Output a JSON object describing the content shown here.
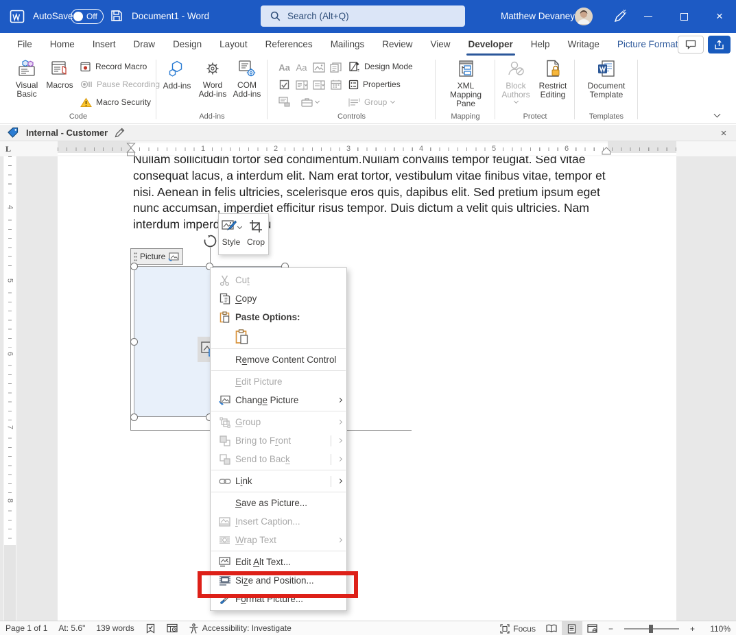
{
  "window": {
    "autosave_label": "AutoSave",
    "autosave_state": "Off",
    "title": "Document1 - Word",
    "search_placeholder": "Search (Alt+Q)",
    "user_name": "Matthew Devaney"
  },
  "ribbon": {
    "tabs": [
      "File",
      "Home",
      "Insert",
      "Draw",
      "Design",
      "Layout",
      "References",
      "Mailings",
      "Review",
      "View",
      "Developer",
      "Help",
      "Writage",
      "Picture Format"
    ],
    "active_tab": "Developer",
    "code": {
      "label": "Code",
      "visual_basic": "Visual Basic",
      "macros": "Macros",
      "record_macro": "Record Macro",
      "pause_recording": "Pause Recording",
      "macro_security": "Macro Security"
    },
    "addins": {
      "label": "Add-ins",
      "add_ins": "Add-ins",
      "word_add_ins": "Word Add-ins",
      "com_add_ins": "COM Add-ins"
    },
    "controls": {
      "label": "Controls",
      "design_mode": "Design Mode",
      "properties": "Properties",
      "group": "Group"
    },
    "mapping": {
      "label": "Mapping",
      "xml_mapping_pane": "XML Mapping Pane"
    },
    "protect": {
      "label": "Protect",
      "block_authors": "Block Authors",
      "restrict_editing": "Restrict Editing"
    },
    "templates": {
      "label": "Templates",
      "document_template": "Document Template"
    }
  },
  "content_tag_bar": {
    "title": "Internal - Customer"
  },
  "ruler": {
    "horizontal": [
      "1",
      "2",
      "3",
      "4",
      "5",
      "6"
    ],
    "vertical": [
      "4",
      "5",
      "6",
      "7",
      "8"
    ]
  },
  "document": {
    "lines": [
      "Nullam sollicitudin tortor sed condimentum.Nullam convallis tempor feugiat. Sed vitae",
      "consequat lacus, a interdum elit. Nam erat tortor, vestibulum vitae finibus vitae, tempor et",
      "nisi. Aenean in felis ultricies, scelerisque eros quis, dapibus elit. Sed pretium ipsum eget",
      "nunc accumsan, imperdiet efficitur risus tempor. Duis dictum a velit quis ultricies. Nam",
      "interdum imperdiet justo u"
    ],
    "picture_tag_label": "Picture"
  },
  "mini_toolbar": {
    "style": "Style",
    "crop": "Crop"
  },
  "context_menu": {
    "cut": "Cu&t",
    "copy": "&Copy",
    "paste_options": "Paste Options:",
    "remove_content_control": "R&emove Content Control",
    "edit_picture": "&Edit Picture",
    "change_picture": "Chang&e Picture",
    "group": "&Group",
    "bring_to_front": "Bring to F&ront",
    "send_to_back": "Send to Bac&k",
    "link": "L&ink",
    "save_as_picture": "&Save as Picture...",
    "insert_caption": "&Insert Caption...",
    "wrap_text": "&Wrap Text",
    "edit_alt_text": "Edit &Alt Text...",
    "size_and_position": "Si&ze and Position...",
    "format_picture": "F&ormat Picture..."
  },
  "status_bar": {
    "page": "Page 1 of 1",
    "position": "At: 5.6\"",
    "words": "139 words",
    "accessibility": "Accessibility: Investigate",
    "focus": "Focus",
    "zoom": "110%"
  },
  "icons": {
    "close": "×",
    "minimize": "—",
    "zoom_in": "+",
    "zoom_out": "−",
    "rich_text": "Aa",
    "plain_text": "Aa",
    "dropdown_arrow": "▾"
  },
  "colors": {
    "titlebar_blue": "#1d5ac4",
    "accent_blue": "#185abd",
    "contextual_tab_blue": "#2b579a",
    "highlight_red": "#dd2018",
    "warning_orange": "#f2a33c",
    "selection_fill": "#e8f0fa"
  }
}
